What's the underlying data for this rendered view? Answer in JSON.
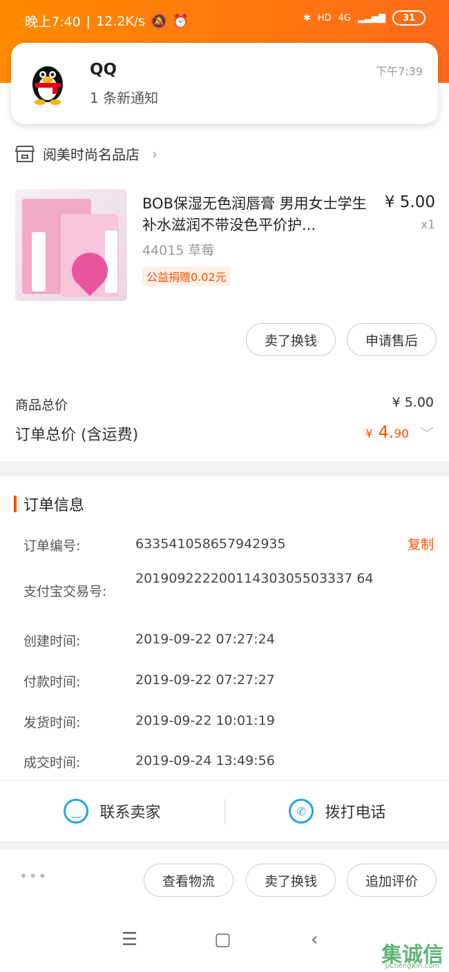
{
  "status_bar": {
    "time": "晚上7:40",
    "speed": "12.2K/s",
    "network": "4G",
    "battery": "31"
  },
  "notification": {
    "app": "QQ",
    "message": "1 条新通知",
    "time": "下午7:39"
  },
  "shop": {
    "name": "阅美时尚名品店"
  },
  "product": {
    "title": "BOB保湿无色润唇膏 男用女士学生补水滋润不带没色平价护...",
    "price": "¥ 5.00",
    "quantity": "x1",
    "variant": "44015 草莓",
    "charity": "公益捐赠0.02元"
  },
  "product_actions": {
    "sell": "卖了换钱",
    "after_sale": "申请售后"
  },
  "totals": {
    "goods_label": "商品总价",
    "goods_value": "¥ 5.00",
    "order_label": "订单总价 (含运费)",
    "order_currency": "¥",
    "order_int": "4.",
    "order_dec": "90"
  },
  "order_info": {
    "title": "订单信息",
    "copy": "复制",
    "rows": [
      {
        "label": "订单编号:",
        "value": "633541058657942935"
      },
      {
        "label": "支付宝交易号:",
        "value": "20190922220011430305503337 64"
      },
      {
        "label": "创建时间:",
        "value": "2019-09-22 07:27:24"
      },
      {
        "label": "付款时间:",
        "value": "2019-09-22 07:27:27"
      },
      {
        "label": "发货时间:",
        "value": "2019-09-22 10:01:19"
      },
      {
        "label": "成交时间:",
        "value": "2019-09-24 13:49:56"
      }
    ]
  },
  "contact": {
    "seller": "联系卖家",
    "call": "拨打电话"
  },
  "bottom_actions": {
    "more": "•••",
    "logistics": "查看物流",
    "sell": "卖了换钱",
    "review": "追加评价"
  },
  "watermark": {
    "text": "集诚信",
    "sub": "JiChengXin.com"
  }
}
